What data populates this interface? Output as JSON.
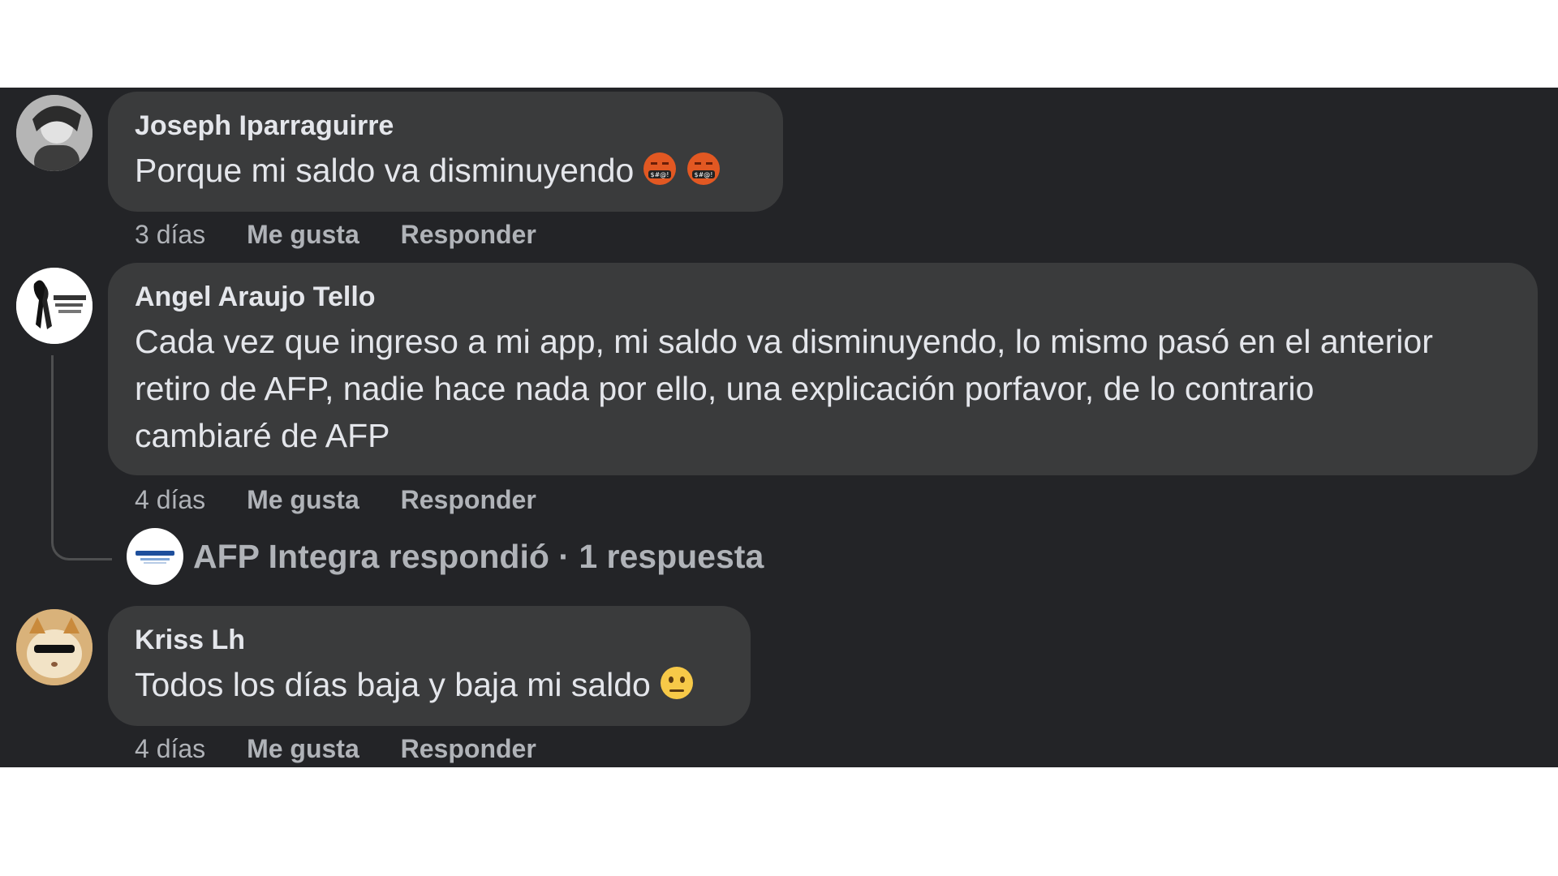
{
  "comments": [
    {
      "author": "Joseph Iparraguirre",
      "text": "Porque mi saldo va disminuyendo",
      "emoji": [
        "angry-cursing-face-icon",
        "angry-cursing-face-icon"
      ],
      "time": "3 días",
      "like_label": "Me gusta",
      "reply_label": "Responder"
    },
    {
      "author": "Angel Araujo Tello",
      "text_lines": [
        "Cada vez que ingreso a mi app, mi saldo va disminuyendo, lo mismo pasó en el anterior",
        "retiro de AFP, nadie hace nada por ello, una explicación porfavor, de lo contrario",
        "cambiaré de AFP"
      ],
      "time": "4 días",
      "like_label": "Me gusta",
      "reply_label": "Responder",
      "replies_summary": "AFP Integra respondió · 1 respuesta"
    },
    {
      "author": "Kriss Lh",
      "text": "Todos los días baja y baja mi saldo",
      "emoji": [
        "neutral-face-icon"
      ],
      "time": "4 días",
      "like_label": "Me gusta",
      "reply_label": "Responder"
    }
  ],
  "colors": {
    "background": "#232427",
    "bubble": "#3a3b3c",
    "primary_text": "#e4e6eb",
    "secondary_text": "#b0b3b8"
  }
}
